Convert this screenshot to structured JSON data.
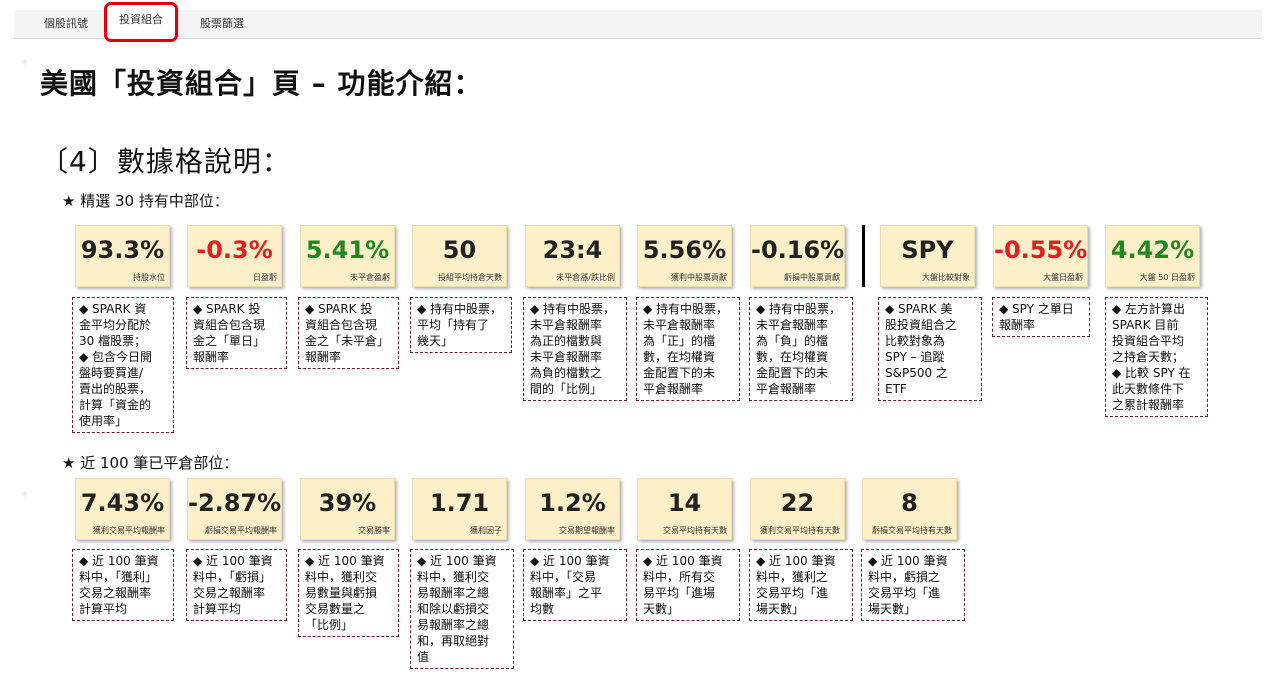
{
  "tabs": [
    {
      "label": "個股訊號",
      "active": false
    },
    {
      "label": "投資組合",
      "active": true
    },
    {
      "label": "股票篩選",
      "active": false
    }
  ],
  "page_title": "美國「投資組合」頁 – 功能介紹：",
  "subtitle": "〔4〕數據格說明：",
  "section1": {
    "heading": "★ 精選 30 持有中部位：",
    "cards": [
      {
        "value": "93.3%",
        "label": "持股水位",
        "tone": "neu"
      },
      {
        "value": "-0.3%",
        "label": "日盈虧",
        "tone": "neg"
      },
      {
        "value": "5.41%",
        "label": "未平倉盈虧",
        "tone": "pos"
      },
      {
        "value": "50",
        "label": "投組平均持倉天數",
        "tone": "neu"
      },
      {
        "value": "23:4",
        "label": "未平倉漲/跌比例",
        "tone": "neu"
      },
      {
        "value": "5.56%",
        "label": "獲利中股票貢獻",
        "tone": "neu"
      },
      {
        "value": "-0.16%",
        "label": "虧損中股票貢獻",
        "tone": "neu"
      },
      {
        "value": "SPY",
        "label": "大盤比較對象",
        "tone": "neu"
      },
      {
        "value": "-0.55%",
        "label": "大盤日盈虧",
        "tone": "neg"
      },
      {
        "value": "4.42%",
        "label": "大盤 50 日盈虧",
        "tone": "pos"
      }
    ],
    "notes": [
      [
        "◆ SPARK 資",
        "金平均分配於",
        "30 檔股票；",
        "◆ 包含今日開",
        "盤時要買進/",
        "賣出的股票，",
        "計算「資金的",
        "使用率」"
      ],
      [
        "◆ SPARK 投",
        "資組合包含現",
        "金之「單日」",
        "報酬率"
      ],
      [
        "◆ SPARK 投",
        "資組合包含現",
        "金之「未平倉」",
        "報酬率"
      ],
      [
        "◆ 持有中股票，",
        "平均「持有了",
        "幾天」"
      ],
      [
        "◆ 持有中股票，",
        "未平倉報酬率",
        "為正的檔數與",
        "未平倉報酬率",
        "為負的檔數之",
        "間的「比例」"
      ],
      [
        "◆ 持有中股票，",
        "未平倉報酬率",
        "為「正」的檔",
        "數，在均權資",
        "金配置下的未",
        "平倉報酬率"
      ],
      [
        "◆ 持有中股票，",
        "未平倉報酬率",
        "為「負」的檔",
        "數，在均權資",
        "金配置下的未",
        "平倉報酬率"
      ],
      [
        "◆ SPARK 美",
        "股投資組合之",
        "比較對象為",
        "SPY – 追蹤",
        "S&P500 之",
        "ETF"
      ],
      [
        "◆ SPY 之單日",
        "報酬率"
      ],
      [
        "◆ 左方計算出",
        "SPARK 目前",
        "投資組合平均",
        "之持倉天數；",
        "◆ 比較 SPY 在",
        "此天數條件下",
        "之累計報酬率"
      ]
    ]
  },
  "section2": {
    "heading": "★ 近 100 筆已平倉部位：",
    "cards": [
      {
        "value": "7.43%",
        "label": "獲利交易平均報酬率",
        "tone": "neu"
      },
      {
        "value": "-2.87%",
        "label": "虧損交易平均報酬率",
        "tone": "neu"
      },
      {
        "value": "39%",
        "label": "交易勝率",
        "tone": "neu"
      },
      {
        "value": "1.71",
        "label": "獲利因子",
        "tone": "neu"
      },
      {
        "value": "1.2%",
        "label": "交易期望報酬率",
        "tone": "neu"
      },
      {
        "value": "14",
        "label": "交易平均持有天數",
        "tone": "neu"
      },
      {
        "value": "22",
        "label": "獲利交易平均持有天數",
        "tone": "neu"
      },
      {
        "value": "8",
        "label": "虧損交易平均持有天數",
        "tone": "neu"
      }
    ],
    "notes": [
      [
        "◆ 近 100 筆資",
        "料中，「獲利」",
        "交易之報酬率",
        "計算平均"
      ],
      [
        "◆ 近 100 筆資",
        "料中，「虧損」",
        "交易之報酬率",
        "計算平均"
      ],
      [
        "◆ 近 100 筆資",
        "料中，獲利交",
        "易數量與虧損",
        "交易數量之",
        "「比例」"
      ],
      [
        "◆ 近 100 筆資",
        "料中，獲利交",
        "易報酬率之總",
        "和除以虧損交",
        "易報酬率之總",
        "和，再取絕對",
        "值"
      ],
      [
        "◆ 近 100 筆資",
        "料中，「交易",
        "報酬率」之平",
        "均數"
      ],
      [
        "◆ 近 100 筆資",
        "料中，所有交",
        "易平均「進場",
        "天數」"
      ],
      [
        "◆ 近 100 筆資",
        "料中，獲利之",
        "交易平均「進",
        "場天數」"
      ],
      [
        "◆ 近 100 筆資",
        "料中，虧損之",
        "交易平均「進",
        "場天數」"
      ]
    ]
  },
  "colors": {
    "negative": "#e01f1f",
    "positive": "#1e8a1e",
    "card_bg": "#fdf0c9",
    "highlight": "#e0000f"
  }
}
